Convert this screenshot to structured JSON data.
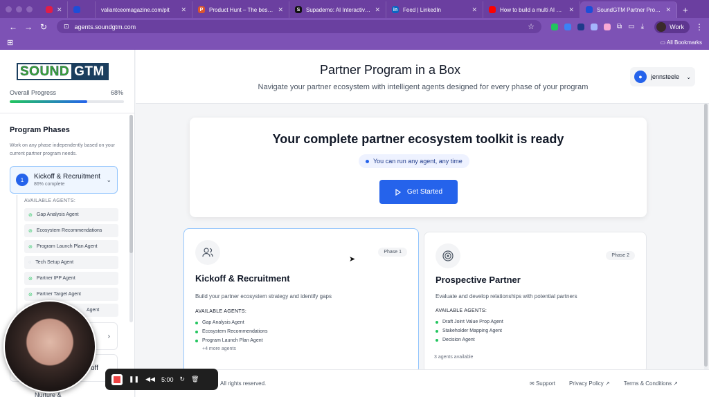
{
  "browser": {
    "tabs": [
      {
        "title": "",
        "fav_color": "#e11d48",
        "fav": ""
      },
      {
        "title": "",
        "fav_color": "#1d4ed8",
        "fav": ""
      },
      {
        "title": "valiantceomagazine.com/pit",
        "fav_color": "#7d52b5",
        "fav": ""
      },
      {
        "title": "Product Hunt – The best new",
        "fav_color": "#da552f",
        "fav": "P"
      },
      {
        "title": "Supademo: AI Interactive Pro",
        "fav_color": "#111111",
        "fav": "S"
      },
      {
        "title": "Feed | LinkedIn",
        "fav_color": "#0a66c2",
        "fav": "in"
      },
      {
        "title": "How to build a multi AI agent",
        "fav_color": "#ff0000",
        "fav": ""
      },
      {
        "title": "SoundGTM Partner Program",
        "fav_color": "#1d4ed8",
        "fav": ""
      }
    ],
    "url": "agents.soundgtm.com",
    "profile_label": "Work",
    "bookmarks_label": "All Bookmarks"
  },
  "sidebar": {
    "logo_left": "SOUND",
    "logo_right": "GTM",
    "progress_label": "Overall Progress",
    "progress_value": "68%",
    "progress_fraction": 0.68,
    "phases_title": "Program Phases",
    "phases_desc": "Work on any phase independently based on your current partner program needs.",
    "active_phase": {
      "number": "1",
      "name": "Kickoff & Recruitment",
      "status": "86% complete"
    },
    "agents_label": "AVAILABLE AGENTS:",
    "agents": [
      {
        "name": "Gap Analysis Agent",
        "done": true
      },
      {
        "name": "Ecosystem Recommendations",
        "done": true
      },
      {
        "name": "Program Launch Plan Agent",
        "done": true
      },
      {
        "name": "Tech Setup Agent",
        "done": false
      },
      {
        "name": "Partner IPP Agent",
        "done": true
      },
      {
        "name": "Partner Target Agent",
        "done": true
      },
      {
        "name": "Agent",
        "done": true
      }
    ],
    "collapsed_phase_2_label": "",
    "collapsed_phase_3_label": "off",
    "nurture_label": "Nurture &"
  },
  "header": {
    "title": "Partner Program in a Box",
    "subtitle": "Navigate your partner ecosystem with intelligent agents designed for every phase of your program",
    "username": "jennsteele"
  },
  "hero": {
    "title": "Your complete partner ecosystem toolkit is ready",
    "pill": "You can run any agent, any time",
    "button": "Get Started"
  },
  "cards": [
    {
      "badge": "Phase 1",
      "title": "Kickoff & Recruitment",
      "desc": "Build your partner ecosystem strategy and identify gaps",
      "agents_label": "AVAILABLE AGENTS:",
      "agents": [
        "Gap Analysis Agent",
        "Ecosystem Recommendations",
        "Program Launch Plan Agent"
      ],
      "more": "+4 more agents"
    },
    {
      "badge": "Phase 2",
      "title": "Prospective Partner",
      "desc": "Evaluate and develop relationships with potential partners",
      "agents_label": "AVAILABLE AGENTS:",
      "agents": [
        "Draft Joint Value Prop Agent",
        "Stakeholder Mapping Agent",
        "Decision Agent"
      ],
      "available": "3 agents available"
    }
  ],
  "footer": {
    "copyright": "All rights reserved.",
    "support": "Support",
    "privacy": "Privacy Policy",
    "terms": "Terms & Conditions"
  },
  "recorder": {
    "time": "5:00"
  }
}
